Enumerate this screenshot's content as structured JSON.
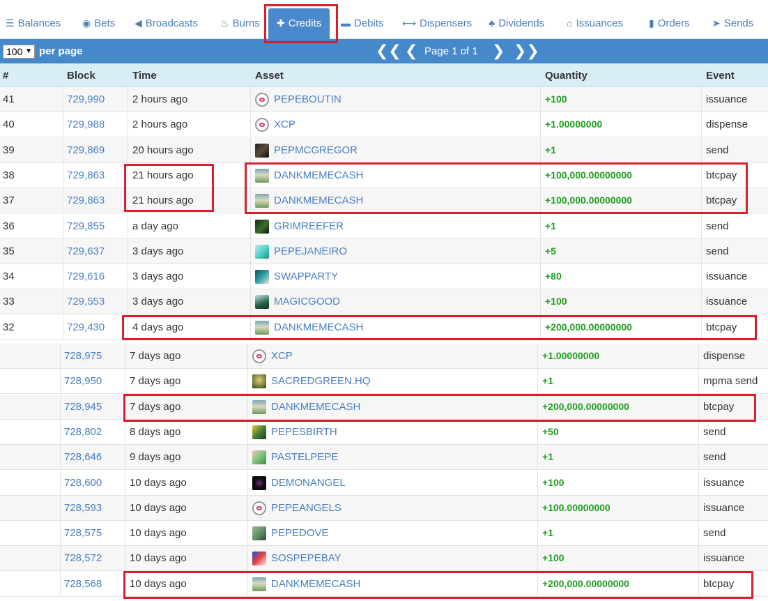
{
  "tabs": [
    {
      "label": "Balances",
      "icon": "list-icon",
      "glyph": "☰"
    },
    {
      "label": "Bets",
      "icon": "bullseye-icon",
      "glyph": "◉"
    },
    {
      "label": "Broadcasts",
      "icon": "megaphone-icon",
      "glyph": "◀"
    },
    {
      "label": "Burns",
      "icon": "flame-icon",
      "glyph": "♨"
    },
    {
      "label": "Credits",
      "icon": "plus-icon",
      "glyph": "✚"
    },
    {
      "label": "Debits",
      "icon": "minus-icon",
      "glyph": "▬"
    },
    {
      "label": "Dispensers",
      "icon": "arrows-horizontal-icon",
      "glyph": "⟷"
    },
    {
      "label": "Dividends",
      "icon": "sitemap-icon",
      "glyph": "♣"
    },
    {
      "label": "Issuances",
      "icon": "bank-icon",
      "glyph": "⌂"
    },
    {
      "label": "Orders",
      "icon": "book-icon",
      "glyph": "▮"
    },
    {
      "label": "Sends",
      "icon": "paper-plane-icon",
      "glyph": "➤"
    }
  ],
  "pager": {
    "per_page_value": "100",
    "per_page_label": "per page",
    "page_text": "Page 1 of 1",
    "first_glyph": "❮❮",
    "prev_glyph": "❮",
    "next_glyph": "❯",
    "last_glyph": "❯❯"
  },
  "columns": {
    "num": "#",
    "block": "Block",
    "time": "Time",
    "asset": "Asset",
    "quantity": "Quantity",
    "event": "Event"
  },
  "rows_top": [
    {
      "num": "41",
      "block": "729,990",
      "time": "2 hours ago",
      "asset": "PEPEBOUTIN",
      "icon": "xcp",
      "quantity": "+100",
      "event": "issuance"
    },
    {
      "num": "40",
      "block": "729,988",
      "time": "2 hours ago",
      "asset": "XCP",
      "icon": "xcp",
      "quantity": "+1.00000000",
      "event": "dispense"
    },
    {
      "num": "39",
      "block": "729,869",
      "time": "20 hours ago",
      "asset": "PEPMCGREGOR",
      "icon": "dark",
      "quantity": "+1",
      "event": "send"
    },
    {
      "num": "38",
      "block": "729,863",
      "time": "21 hours ago",
      "asset": "DANKMEMECASH",
      "icon": "dank",
      "quantity": "+100,000.00000000",
      "event": "btcpay"
    },
    {
      "num": "37",
      "block": "729,863",
      "time": "21 hours ago",
      "asset": "DANKMEMECASH",
      "icon": "dank",
      "quantity": "+100,000.00000000",
      "event": "btcpay"
    },
    {
      "num": "36",
      "block": "729,855",
      "time": "a day ago",
      "asset": "GRIMREEFER",
      "icon": "green-dark",
      "quantity": "+1",
      "event": "send"
    },
    {
      "num": "35",
      "block": "729,637",
      "time": "3 days ago",
      "asset": "PEPEJANEIRO",
      "icon": "cyan",
      "quantity": "+5",
      "event": "send"
    },
    {
      "num": "34",
      "block": "729,616",
      "time": "3 days ago",
      "asset": "SWAPPARTY",
      "icon": "teal",
      "quantity": "+80",
      "event": "issuance"
    },
    {
      "num": "33",
      "block": "729,553",
      "time": "3 days ago",
      "asset": "MAGICGOOD",
      "icon": "forest",
      "quantity": "+100",
      "event": "issuance"
    },
    {
      "num": "32",
      "block": "729,430",
      "time": "4 days ago",
      "asset": "DANKMEMECASH",
      "icon": "dank",
      "quantity": "+200,000.00000000",
      "event": "btcpay"
    }
  ],
  "rows_bottom": [
    {
      "block": "728,975",
      "time": "7 days ago",
      "asset": "XCP",
      "icon": "xcp",
      "quantity": "+1.00000000",
      "event": "dispense"
    },
    {
      "block": "728,950",
      "time": "7 days ago",
      "asset": "SACREDGREEN.HQ",
      "icon": "portrait",
      "quantity": "+1",
      "event": "mpma send"
    },
    {
      "block": "728,945",
      "time": "7 days ago",
      "asset": "DANKMEMECASH",
      "icon": "dank",
      "quantity": "+200,000.00000000",
      "event": "btcpay"
    },
    {
      "block": "728,802",
      "time": "8 days ago",
      "asset": "PEPESBIRTH",
      "icon": "olive",
      "quantity": "+50",
      "event": "send"
    },
    {
      "block": "728,646",
      "time": "9 days ago",
      "asset": "PASTELPEPE",
      "icon": "pastel",
      "quantity": "+1",
      "event": "send"
    },
    {
      "block": "728,600",
      "time": "10 days ago",
      "asset": "DEMONANGEL",
      "icon": "black",
      "quantity": "+100",
      "event": "issuance"
    },
    {
      "block": "728,593",
      "time": "10 days ago",
      "asset": "PEPEANGELS",
      "icon": "xcp",
      "quantity": "+100.00000000",
      "event": "issuance"
    },
    {
      "block": "728,575",
      "time": "10 days ago",
      "asset": "PEPEDOVE",
      "icon": "sage",
      "quantity": "+1",
      "event": "send"
    },
    {
      "block": "728,572",
      "time": "10 days ago",
      "asset": "SOSPEPEBAY",
      "icon": "blue-red",
      "quantity": "+100",
      "event": "issuance"
    },
    {
      "block": "728,568",
      "time": "10 days ago",
      "asset": "DANKMEMECASH",
      "icon": "dank",
      "quantity": "+200,000.00000000",
      "event": "btcpay"
    }
  ],
  "colors": {
    "accent": "#4589ca",
    "link": "#4a7fc1",
    "quantity": "#1e9e1e",
    "highlight_box": "#d81f2c",
    "header_bg": "#d9edf7"
  }
}
